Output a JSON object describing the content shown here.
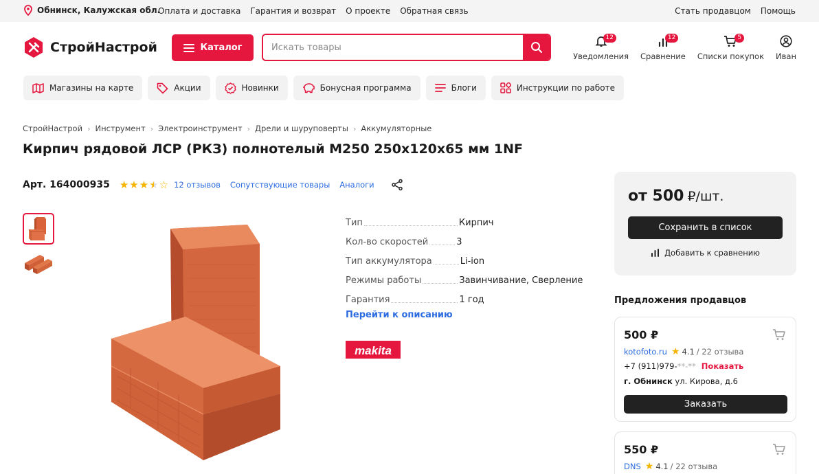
{
  "topbar": {
    "location": "Обнинск, Калужская обл.",
    "links": [
      "Оплата и доставка",
      "Гарантия и возврат",
      "О проекте",
      "Обратная связь"
    ],
    "right_links": [
      "Стать продавцом",
      "Помощь"
    ]
  },
  "header": {
    "logo_text": "СтройНастрой",
    "catalog_label": "Каталог",
    "search_placeholder": "Искать товары",
    "icons": [
      {
        "label": "Уведомления",
        "badge": "12",
        "icon": "bell-icon"
      },
      {
        "label": "Сравнение",
        "badge": "12",
        "icon": "compare-icon"
      },
      {
        "label": "Списки покупок",
        "badge": "5",
        "icon": "cart-icon"
      },
      {
        "label": "Иван",
        "badge": "",
        "icon": "user-icon"
      }
    ]
  },
  "chips": [
    {
      "label": "Магазины на карте",
      "icon": "map-icon"
    },
    {
      "label": "Акции",
      "icon": "tag-icon"
    },
    {
      "label": "Новинки",
      "icon": "new-badge-icon"
    },
    {
      "label": "Бонусная программа",
      "icon": "piggy-bank-icon"
    },
    {
      "label": "Блоги",
      "icon": "list-icon"
    },
    {
      "label": "Инструкции по работе",
      "icon": "grid-icon"
    }
  ],
  "breadcrumb": [
    "СтройНастрой",
    "Инструмент",
    "Электроинструмент",
    "Дрели и шуруповерты",
    "Аккумуляторные"
  ],
  "product": {
    "title": "Кирпич рядовой ЛСР (РКЗ) полнотелый М250 250х120х65 мм 1NF",
    "article": "Арт. 164000935",
    "rating": 3.5,
    "reviews_label": "12 отзывов",
    "related_label": "Сопутствующие товары",
    "analogs_label": "Аналоги",
    "specs": [
      {
        "key": "Тип",
        "value": "Кирпич"
      },
      {
        "key": "Кол-во скоростей",
        "value": "3"
      },
      {
        "key": "Тип аккумулятора",
        "value": "Li-ion"
      },
      {
        "key": "Режимы работы",
        "value": "Завинчивание, Сверление"
      },
      {
        "key": "Гарантия",
        "value": "1 год"
      }
    ],
    "to_description": "Перейти к описанию",
    "brand": "makita"
  },
  "pricebox": {
    "price": "от 500",
    "unit": "₽/шт.",
    "save_label": "Сохранить в список",
    "compare_label": "Добавить к сравнению"
  },
  "offers": {
    "title": "Предложения продавцов",
    "items": [
      {
        "price": "500 ₽",
        "seller": "kotofoto.ru",
        "rating": "4.1",
        "reviews": "/ 22 отзыва",
        "phone": "+7 (911)979-",
        "phone_mask": "**-**",
        "show": "Показать",
        "city": "г. Обнинск",
        "address": "ул. Кирова, д.6",
        "order": "Заказать"
      },
      {
        "price": "550 ₽",
        "seller": "DNS",
        "rating": "4.1",
        "reviews": "/ 22 отзыва"
      }
    ]
  },
  "colors": {
    "accent": "#e5173f",
    "link": "#2c6be0",
    "star": "#f4b400"
  }
}
